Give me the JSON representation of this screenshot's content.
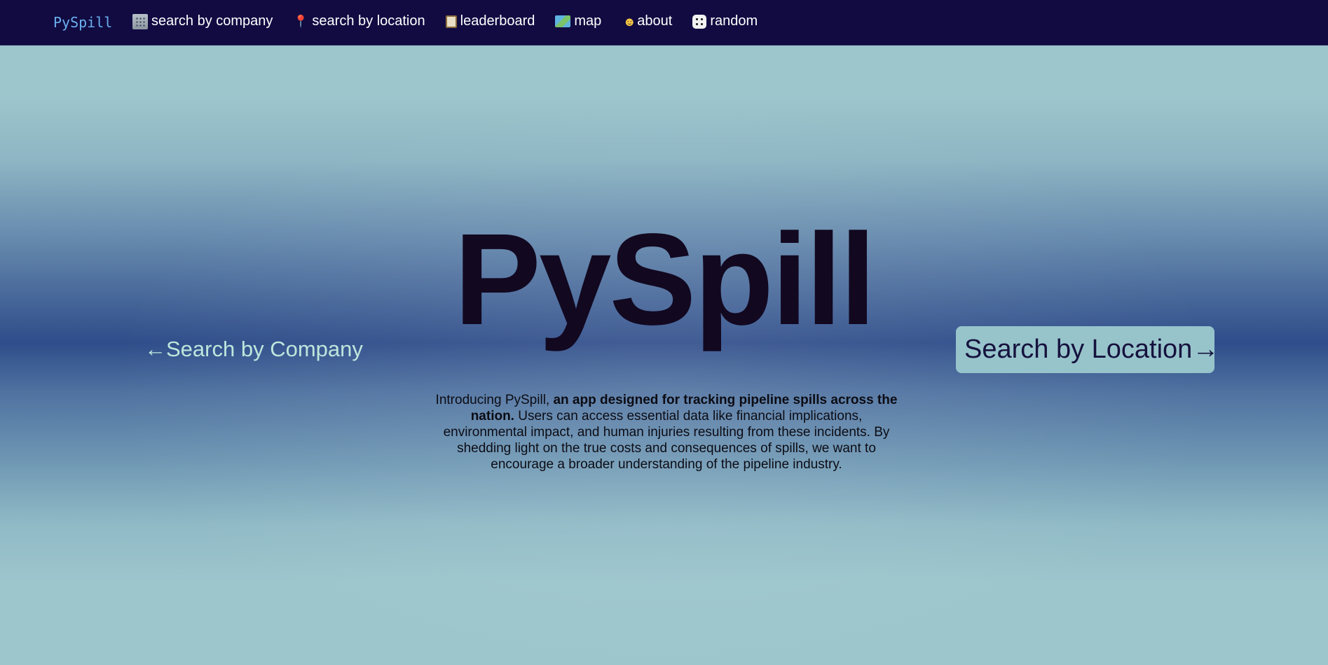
{
  "navbar": {
    "brand": "PySpill",
    "links": [
      {
        "label": "search by company",
        "icon": "building-icon"
      },
      {
        "label": "search by location",
        "icon": "pin-icon"
      },
      {
        "label": "leaderboard",
        "icon": "clipboard-icon"
      },
      {
        "label": "map",
        "icon": "map-icon"
      },
      {
        "label": "about",
        "icon": "person-raising-hand-icon"
      },
      {
        "label": "random",
        "icon": "dice-icon"
      }
    ]
  },
  "hero": {
    "title": "PySpill",
    "left_link": "←Search by Company",
    "right_button": "Search by Location→",
    "intro_prefix": "Introducing PySpill, ",
    "intro_bold": "an app designed for tracking pipeline spills across the nation.",
    "intro_rest": " Users can access essential data like financial implications, environmental impact, and human injuries resulting from these incidents. By shedding light on the true costs and consequences of spills, we want to encourage a broader understanding of the pipeline industry."
  },
  "colors": {
    "navbar_bg": "#110b42",
    "brand": "#6ab0ee",
    "title": "#120820",
    "left_link": "#bde6dc",
    "button_bg": "#97c4cb",
    "button_text": "#16123e"
  }
}
